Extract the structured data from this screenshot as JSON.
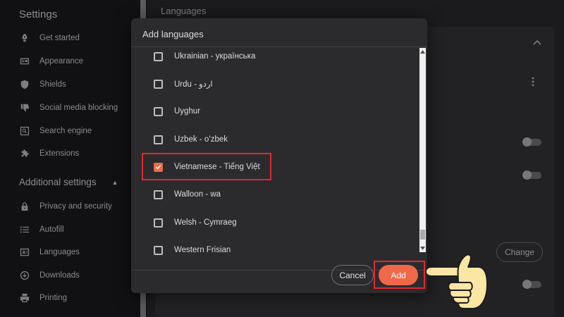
{
  "sidebar": {
    "title": "Settings",
    "items": [
      {
        "label": "Get started",
        "icon": "rocket-icon"
      },
      {
        "label": "Appearance",
        "icon": "appearance-icon"
      },
      {
        "label": "Shields",
        "icon": "shield-icon"
      },
      {
        "label": "Social media blocking",
        "icon": "thumbs-down-icon"
      },
      {
        "label": "Search engine",
        "icon": "search-icon"
      },
      {
        "label": "Extensions",
        "icon": "puzzle-icon"
      }
    ],
    "additional_title": "Additional settings",
    "additional_items": [
      {
        "label": "Privacy and security",
        "icon": "lock-icon"
      },
      {
        "label": "Autofill",
        "icon": "list-icon"
      },
      {
        "label": "Languages",
        "icon": "translate-icon"
      },
      {
        "label": "Downloads",
        "icon": "download-icon"
      },
      {
        "label": "Printing",
        "icon": "printer-icon"
      }
    ]
  },
  "main": {
    "heading": "Languages",
    "change_label": "Change"
  },
  "dialog": {
    "title": "Add languages",
    "languages": [
      {
        "label": "Ukrainian - українська",
        "checked": false
      },
      {
        "label": "Urdu - اردو",
        "checked": false
      },
      {
        "label": "Uyghur",
        "checked": false
      },
      {
        "label": "Uzbek - o‘zbek",
        "checked": false
      },
      {
        "label": "Vietnamese - Tiếng Việt",
        "checked": true
      },
      {
        "label": "Walloon - wa",
        "checked": false
      },
      {
        "label": "Welsh - Cymraeg",
        "checked": false
      },
      {
        "label": "Western Frisian",
        "checked": false
      }
    ],
    "cancel_label": "Cancel",
    "add_label": "Add"
  },
  "colors": {
    "accent": "#f0684a",
    "highlight": "#e3262d"
  },
  "icons": {
    "pointing_hand": "pointing-hand-icon"
  }
}
